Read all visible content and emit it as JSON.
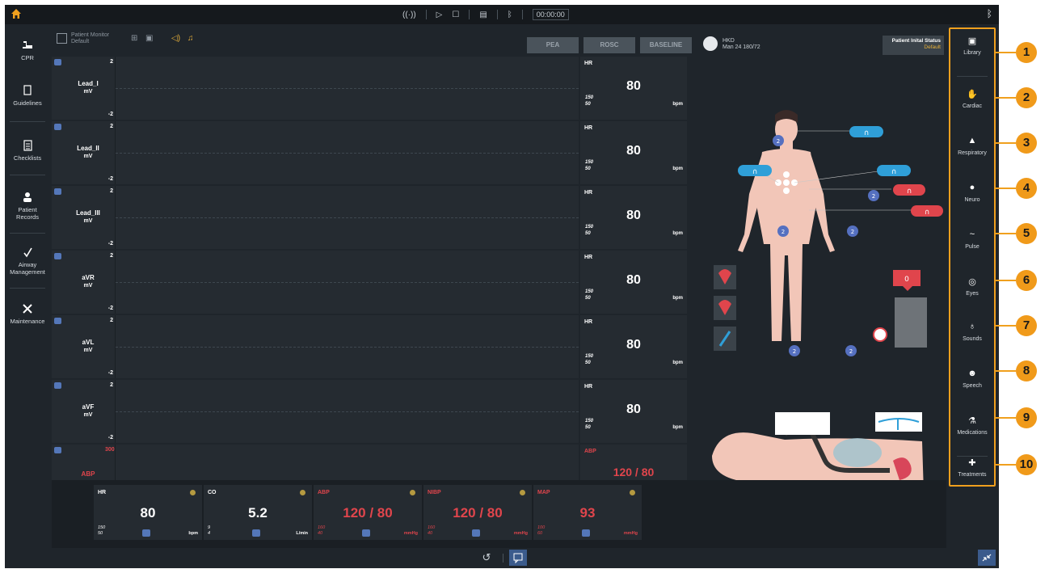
{
  "topbar": {
    "timer": "00:00:00"
  },
  "left_nav": [
    {
      "label": "CPR",
      "icon": "cpr-icon"
    },
    {
      "label": "Guidelines",
      "icon": "guidelines-icon"
    },
    {
      "label": "Checklists",
      "icon": "checklist-icon"
    },
    {
      "label": "Patient Records",
      "icon": "patient-records-icon"
    },
    {
      "label": "Airway Management",
      "icon": "airway-icon"
    },
    {
      "label": "Maintenance",
      "icon": "tools-icon"
    }
  ],
  "header": {
    "monitor_title": "Patient Monitor",
    "monitor_subtitle": "Default",
    "buttons": [
      "PEA",
      "ROSC",
      "BASELINE"
    ],
    "patient_name": "HKD",
    "patient_info": "Man 24 180/72",
    "status_title": "Patient Inital Status",
    "status_value": "Default"
  },
  "waveforms": [
    {
      "label": "Lead_I",
      "unit": "mV",
      "top": "2",
      "bottom": "-2"
    },
    {
      "label": "Lead_II",
      "unit": "mV",
      "top": "2",
      "bottom": "-2"
    },
    {
      "label": "Lead_III",
      "unit": "mV",
      "top": "2",
      "bottom": "-2"
    },
    {
      "label": "aVR",
      "unit": "mV",
      "top": "2",
      "bottom": "-2"
    },
    {
      "label": "aVL",
      "unit": "mV",
      "top": "2",
      "bottom": "-2"
    },
    {
      "label": "aVF",
      "unit": "mV",
      "top": "2",
      "bottom": "-2"
    },
    {
      "label": "ABP",
      "unit": "",
      "top": "300",
      "bottom": ""
    }
  ],
  "vitals_right": [
    {
      "key": "HR",
      "value": "80",
      "hi": "150",
      "lo": "50",
      "unit": "bpm"
    },
    {
      "key": "HR",
      "value": "80",
      "hi": "150",
      "lo": "50",
      "unit": "bpm"
    },
    {
      "key": "HR",
      "value": "80",
      "hi": "150",
      "lo": "50",
      "unit": "bpm"
    },
    {
      "key": "HR",
      "value": "80",
      "hi": "150",
      "lo": "50",
      "unit": "bpm"
    },
    {
      "key": "HR",
      "value": "80",
      "hi": "150",
      "lo": "50",
      "unit": "bpm"
    },
    {
      "key": "HR",
      "value": "80",
      "hi": "150",
      "lo": "50",
      "unit": "bpm"
    },
    {
      "key": "ABP",
      "value": "120 / 80",
      "hi": "",
      "lo": "",
      "unit": ""
    }
  ],
  "figure": {
    "badge_value": "2",
    "alarm_value": "0",
    "angle": "0°"
  },
  "vitals_bottom": [
    {
      "key": "HR",
      "value": "80",
      "hi": "150",
      "lo": "50",
      "unit": "bpm"
    },
    {
      "key": "CO",
      "value": "5.2",
      "hi": "9",
      "lo": "4",
      "unit": "L/min"
    },
    {
      "key": "ABP",
      "value": "120 / 80",
      "hi": "160",
      "lo": "40",
      "unit": "mmHg"
    },
    {
      "key": "NIBP",
      "value": "120 / 80",
      "hi": "160",
      "lo": "40",
      "unit": "mmHg"
    },
    {
      "key": "MAP",
      "value": "93",
      "hi": "100",
      "lo": "60",
      "unit": "mmHg"
    }
  ],
  "right_nav": [
    {
      "label": "Library",
      "icon": "library-icon"
    },
    {
      "label": "Cardiac",
      "icon": "cardiac-icon"
    },
    {
      "label": "Respiratory",
      "icon": "lungs-icon"
    },
    {
      "label": "Neuro",
      "icon": "brain-icon"
    },
    {
      "label": "Pulse",
      "icon": "pulse-icon"
    },
    {
      "label": "Eyes",
      "icon": "eye-icon"
    },
    {
      "label": "Sounds",
      "icon": "stethoscope-icon"
    },
    {
      "label": "Speech",
      "icon": "speech-icon"
    },
    {
      "label": "Medications",
      "icon": "pills-icon"
    },
    {
      "label": "Treatments",
      "icon": "treatment-icon"
    }
  ],
  "callouts": [
    "1",
    "2",
    "3",
    "4",
    "5",
    "6",
    "7",
    "8",
    "9",
    "10"
  ],
  "colors": {
    "background": "#1f252b",
    "accent": "#f09a1a",
    "alarm": "#e0454c",
    "button_blue": "#3b5b8c",
    "electrode_blue": "#2f9fd8"
  }
}
